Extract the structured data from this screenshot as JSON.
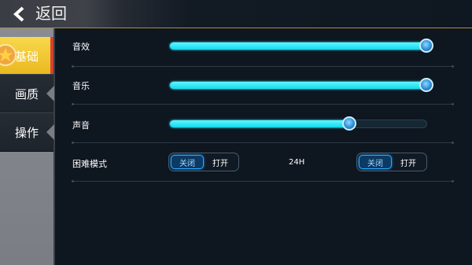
{
  "header": {
    "title": "返回",
    "back_icon": "chevron-left-icon"
  },
  "sidebar": {
    "items": [
      {
        "label": "基础",
        "active": true
      },
      {
        "label": "画质",
        "active": false
      },
      {
        "label": "操作",
        "active": false
      }
    ]
  },
  "settings": {
    "sound_effects": {
      "label": "音效",
      "value": 1.0
    },
    "music": {
      "label": "音乐",
      "value": 1.0
    },
    "voice": {
      "label": "声音",
      "value": 0.7
    },
    "hard_mode": {
      "label": "困难模式",
      "toggle1": {
        "off": "关闭",
        "on": "打开",
        "selected": "关闭"
      },
      "middle_label": "24H",
      "toggle2": {
        "off": "关闭",
        "on": "打开",
        "selected": "关闭"
      }
    }
  },
  "colors": {
    "accent": "#1dd9ee",
    "active_tab": "#f2c933",
    "header_border": "#b08d3a"
  }
}
